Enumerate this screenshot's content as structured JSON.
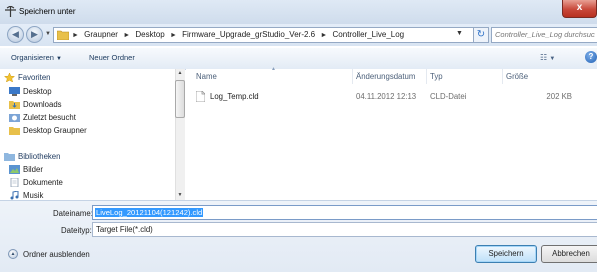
{
  "window": {
    "title": "Speichern unter",
    "close_label": "x"
  },
  "address": {
    "crumbs": [
      "Graupner",
      "Desktop",
      "Firmware_Upgrade_grStudio_Ver-2.6",
      "Controller_Live_Log"
    ],
    "search_placeholder": "Controller_Live_Log durchsuch..."
  },
  "toolbar": {
    "organize_label": "Organisieren",
    "new_folder_label": "Neuer Ordner"
  },
  "nav": {
    "favorites_header": "Favoriten",
    "favorites": [
      "Desktop",
      "Downloads",
      "Zuletzt besucht",
      "Desktop Graupner"
    ],
    "libraries_header": "Bibliotheken",
    "libraries": [
      "Bilder",
      "Dokumente",
      "Musik"
    ]
  },
  "filelist": {
    "columns": [
      "Name",
      "Änderungsdatum",
      "Typ",
      "Größe"
    ],
    "rows": [
      {
        "name": "Log_Temp.cld",
        "date": "04.11.2012 12:13",
        "type": "CLD-Datei",
        "size": "202 KB"
      }
    ]
  },
  "bottom": {
    "filename_label": "Dateiname:",
    "filename_value": "LiveLog_20121104(121242).cld",
    "filetype_label": "Dateityp:",
    "filetype_value": "Target File(*.cld)",
    "hide_folders_label": "Ordner ausblenden",
    "save_label": "Speichern",
    "cancel_label": "Abbrechen"
  },
  "colors": {
    "selection": "#3399ff",
    "titlebar": "#dfe9f5",
    "close_button": "#c8483a"
  }
}
